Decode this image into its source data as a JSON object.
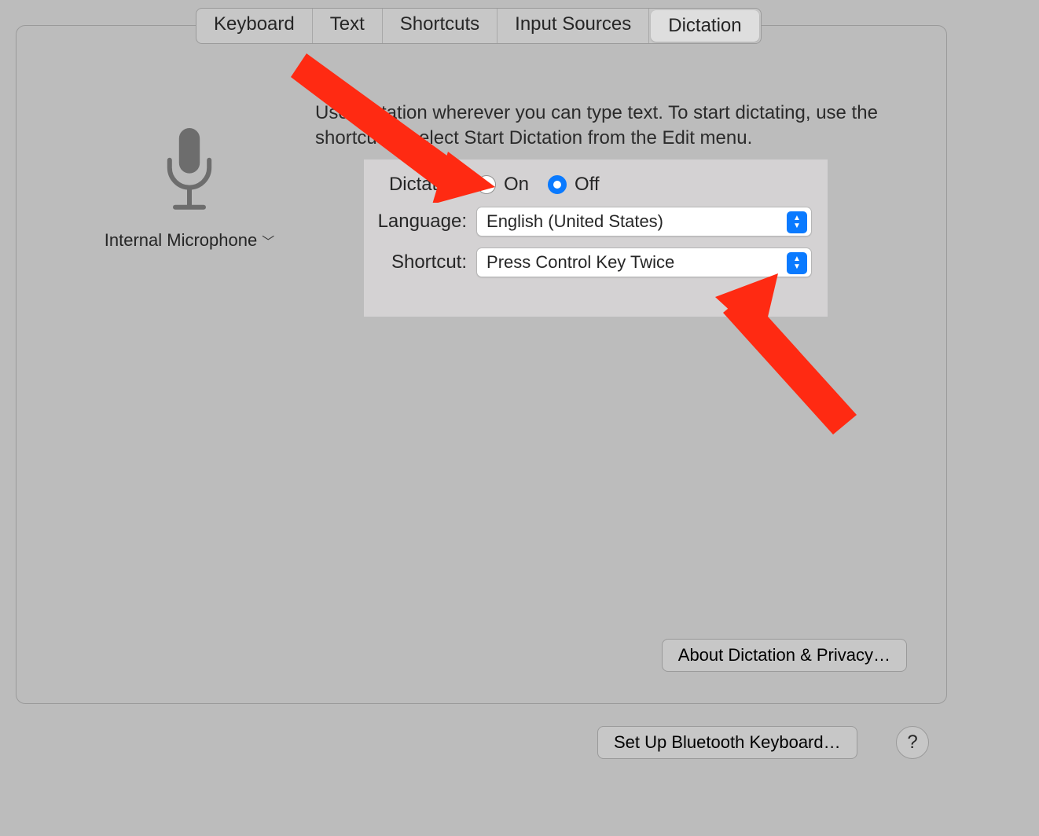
{
  "tabs": {
    "keyboard": "Keyboard",
    "text": "Text",
    "shortcuts": "Shortcuts",
    "inputSources": "Input Sources",
    "dictation": "Dictation",
    "active": "dictation"
  },
  "mic": {
    "label": "Internal Microphone"
  },
  "description": "Use Dictation wherever you can type text. To start dictating, use the shortcut or select Start Dictation from the Edit menu.",
  "settings": {
    "dictationLabel": "Dictation:",
    "dictationOn": "On",
    "dictationOff": "Off",
    "dictationValue": "off",
    "languageLabel": "Language:",
    "languageValue": "English (United States)",
    "shortcutLabel": "Shortcut:",
    "shortcutValue": "Press Control Key Twice"
  },
  "buttons": {
    "about": "About Dictation & Privacy…",
    "bluetooth": "Set Up Bluetooth Keyboard…",
    "help": "?"
  }
}
